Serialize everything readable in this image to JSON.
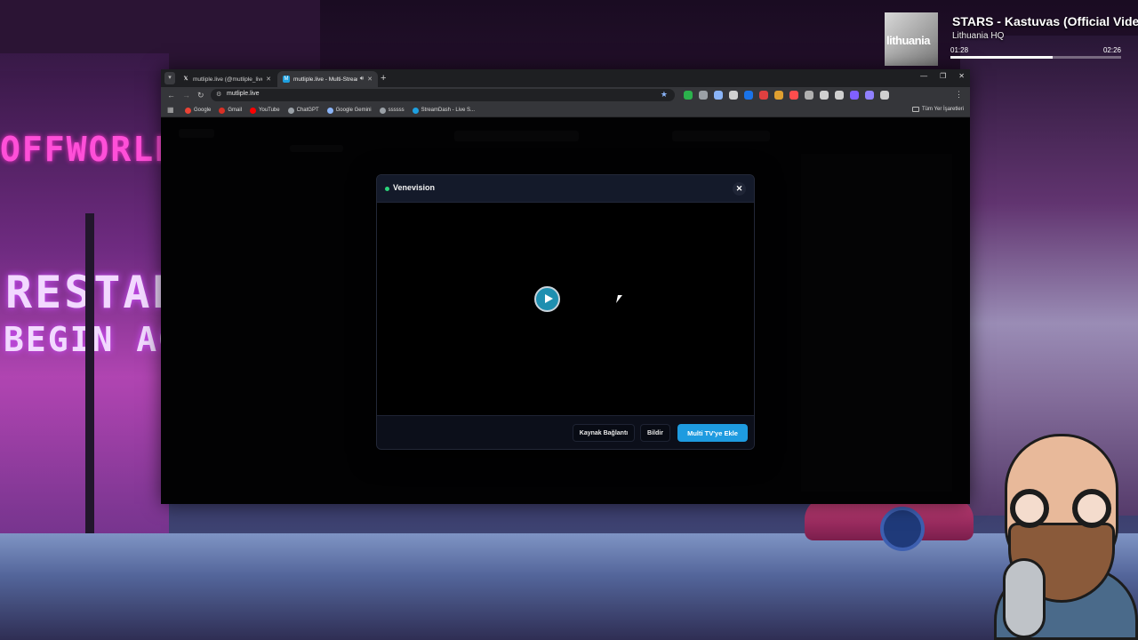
{
  "now_playing": {
    "title": "STARS - Kastuvas (Official Video)",
    "artist": "Lithuania HQ",
    "art_text": "lithuania",
    "time_elapsed": "01:28",
    "time_total": "02:26",
    "progress": 0.6
  },
  "scene": {
    "sign_top": "OFFWORLD",
    "sign_mid": "RESTAR",
    "sign_low": "BEGIN AG"
  },
  "browser": {
    "tabs": [
      {
        "label": "mutliple.live (@mutliple_live) /",
        "favicon": "x-icon",
        "active": false
      },
      {
        "label": "mutliple.live - Multi-Stream",
        "favicon": "M",
        "active": true
      }
    ],
    "new_tab": "+",
    "window_controls": {
      "minimize": "—",
      "maximize": "❐",
      "close": "✕"
    },
    "url": "mutliple.live",
    "bookmarks": [
      {
        "label": "Google",
        "color": "#ea4335"
      },
      {
        "label": "Gmail",
        "color": "#d93025"
      },
      {
        "label": "YouTube",
        "color": "#ff0000"
      },
      {
        "label": "ChatGPT",
        "color": "#9aa0a6"
      },
      {
        "label": "Google Gemini",
        "color": "#8ab4f8"
      },
      {
        "label": "ssssss",
        "color": "#9aa0a6"
      },
      {
        "label": "StreamDash - Live S...",
        "color": "#1ea0e0"
      }
    ],
    "all_bookmarks": "Tüm Yer İşaretleri",
    "extensions": [
      "#2bb24c",
      "#9aa0a6",
      "#8ab4f8",
      "#d0d0d0",
      "#1a73e8",
      "#e04040",
      "#e0a030",
      "#ff4d4d",
      "#b0b0b0",
      "#d0d0d0",
      "#d0d0d0",
      "#8060ff",
      "#9080ff",
      "#d0d0d0"
    ]
  },
  "modal": {
    "channel_name": "Venevision",
    "close_label": "✕",
    "buttons": {
      "source_link": "Kaynak Bağlantı",
      "report": "Bildir",
      "add_multi_tv": "Multi TV'ye Ekle"
    }
  }
}
